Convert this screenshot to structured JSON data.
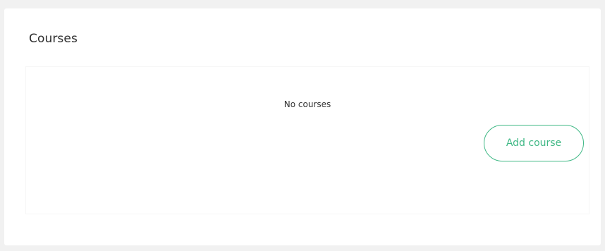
{
  "courses": {
    "title": "Courses",
    "empty_message": "No courses",
    "add_button_label": "Add course"
  },
  "colors": {
    "accent": "#3fb885",
    "background": "#f1f1f1",
    "card": "#ffffff",
    "text": "#2b2b2b"
  }
}
